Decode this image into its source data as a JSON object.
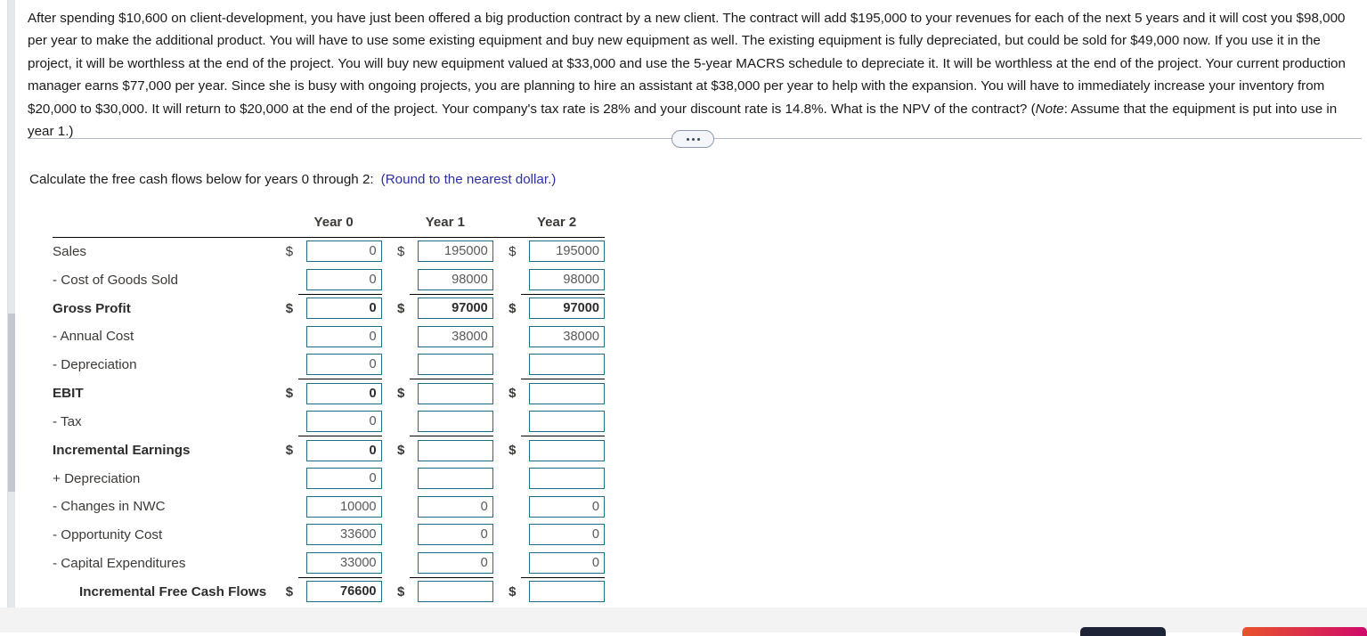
{
  "question": {
    "paragraph": "After spending $10,600 on client-development, you have just been offered a big production contract by a new client. The contract will add $195,000 to your revenues for each of the next 5 years and it will cost you $98,000 per year to make the additional product. You will have to use some existing equipment and buy new equipment as well. The existing equipment is fully depreciated, but could be sold for $49,000 now. If you use it in the project, it will be worthless at the end of the project. You will buy new equipment valued at $33,000 and use the 5-year MACRS schedule to depreciate it. It will be worthless at the end of the project. Your current production manager earns $77,000 per year. Since she is busy with ongoing projects, you are planning to hire an assistant at $38,000 per year to help with the expansion. You will have to immediately increase your inventory from $20,000 to $30,000. It will return to $20,000 at the end of the project. Your company's tax rate is 28% and your discount rate is 14.8%. What is the NPV of the contract? (",
    "note_italic": "Note",
    "note_rest": ": Assume that the equipment is put into use in year 1.)"
  },
  "divider": {
    "expander_label": "more-options"
  },
  "instruction": {
    "text": "Calculate the free cash flows below for years 0 through 2:",
    "rounding_note": "(Round to the nearest dollar.)"
  },
  "table": {
    "headers": [
      "Year 0",
      "Year 1",
      "Year 2"
    ],
    "rows": [
      {
        "label": "Sales",
        "bold": false,
        "indent": false,
        "show_dollar": [
          true,
          true,
          true
        ],
        "values": [
          "0",
          "195000",
          "195000"
        ],
        "rule_above": false
      },
      {
        "label": "- Cost of Goods Sold",
        "bold": false,
        "indent": false,
        "show_dollar": [
          false,
          false,
          false
        ],
        "values": [
          "0",
          "98000",
          "98000"
        ],
        "rule_above": false
      },
      {
        "label": "Gross Profit",
        "bold": true,
        "indent": false,
        "show_dollar": [
          true,
          true,
          true
        ],
        "values": [
          "0",
          "97000",
          "97000"
        ],
        "rule_above": true
      },
      {
        "label": "- Annual Cost",
        "bold": false,
        "indent": false,
        "show_dollar": [
          false,
          false,
          false
        ],
        "values": [
          "0",
          "38000",
          "38000"
        ],
        "rule_above": false
      },
      {
        "label": "- Depreciation",
        "bold": false,
        "indent": false,
        "show_dollar": [
          false,
          false,
          false
        ],
        "values": [
          "0",
          "",
          ""
        ],
        "rule_above": false
      },
      {
        "label": "EBIT",
        "bold": true,
        "indent": false,
        "show_dollar": [
          true,
          true,
          true
        ],
        "values": [
          "0",
          "",
          ""
        ],
        "rule_above": true
      },
      {
        "label": "- Tax",
        "bold": false,
        "indent": false,
        "show_dollar": [
          false,
          false,
          false
        ],
        "values": [
          "0",
          "",
          ""
        ],
        "rule_above": false
      },
      {
        "label": "Incremental Earnings",
        "bold": true,
        "indent": false,
        "show_dollar": [
          true,
          true,
          true
        ],
        "values": [
          "0",
          "",
          ""
        ],
        "rule_above": true
      },
      {
        "label": "+ Depreciation",
        "bold": false,
        "indent": false,
        "show_dollar": [
          false,
          false,
          false
        ],
        "values": [
          "0",
          "",
          ""
        ],
        "rule_above": false
      },
      {
        "label": "- Changes in NWC",
        "bold": false,
        "indent": false,
        "show_dollar": [
          false,
          false,
          false
        ],
        "values": [
          "10000",
          "0",
          "0"
        ],
        "rule_above": false
      },
      {
        "label": "- Opportunity Cost",
        "bold": false,
        "indent": false,
        "show_dollar": [
          false,
          false,
          false
        ],
        "values": [
          "33600",
          "0",
          "0"
        ],
        "rule_above": false
      },
      {
        "label": "- Capital Expenditures",
        "bold": false,
        "indent": false,
        "show_dollar": [
          false,
          false,
          false
        ],
        "values": [
          "33000",
          "0",
          "0"
        ],
        "rule_above": false
      },
      {
        "label": "Incremental Free Cash Flows",
        "bold": true,
        "indent": true,
        "show_dollar": [
          true,
          true,
          true
        ],
        "values": [
          "76600",
          "",
          ""
        ],
        "rule_above": true
      }
    ],
    "currency_symbol": "$"
  },
  "colors": {
    "field_border": "#1c7189",
    "note_blue": "#2f2fa8",
    "rule_black": "#000000",
    "bottom_bar": "#f3f3f4",
    "button_dark": "#1e2438",
    "button_accent_start": "#e8532b",
    "button_accent_end": "#cf0a6b"
  },
  "bottom_buttons": [
    {
      "name": "primary-action-button",
      "style": "dark"
    },
    {
      "name": "secondary-action-button",
      "style": "accent"
    }
  ]
}
